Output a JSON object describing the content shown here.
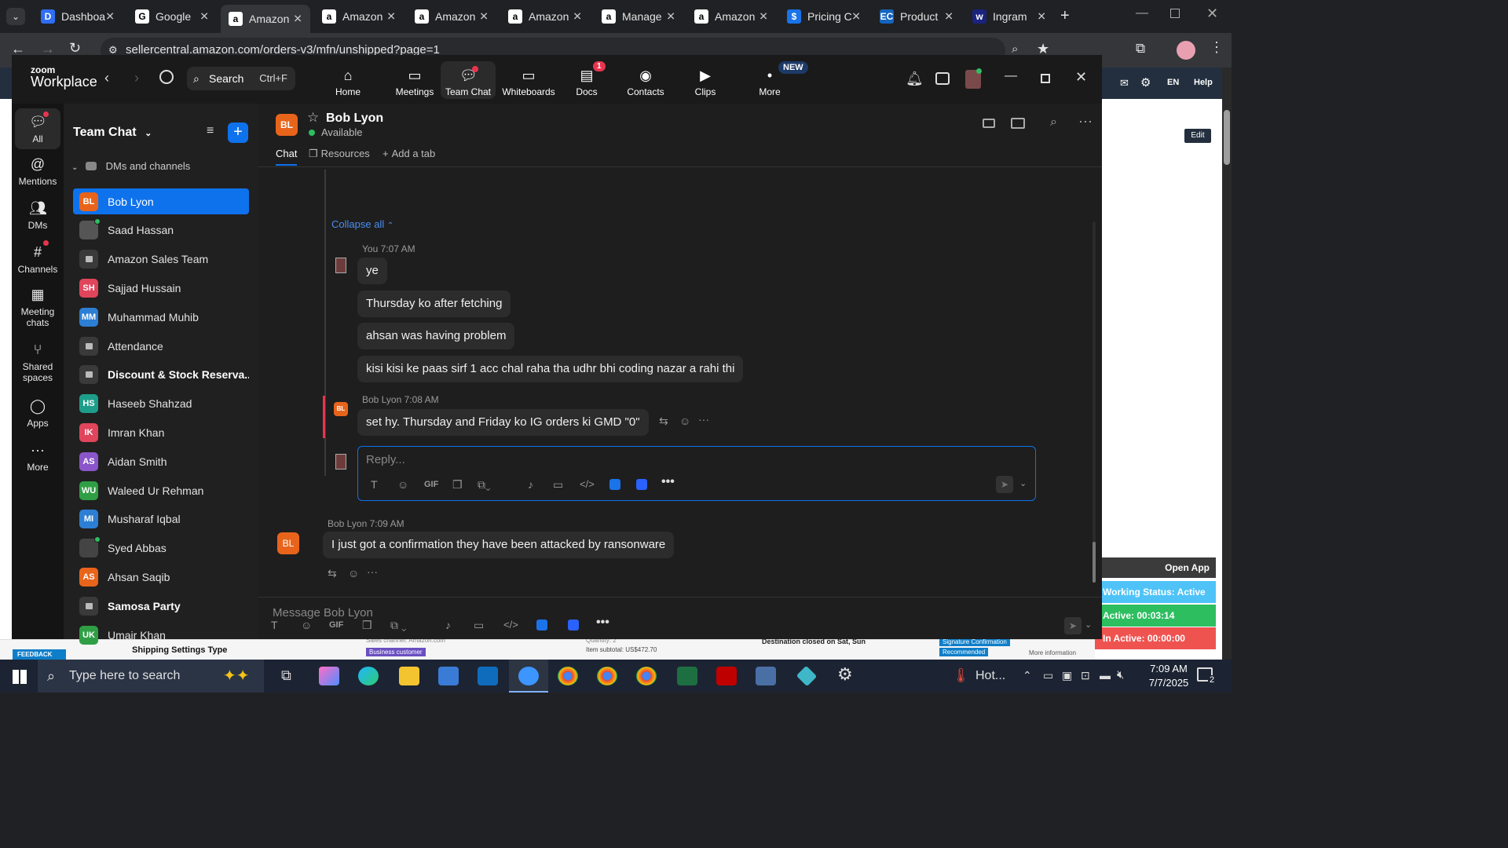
{
  "browser": {
    "tabs": [
      {
        "label": "Dashboa",
        "fav": "D",
        "color": "#2f6df5"
      },
      {
        "label": "Google",
        "fav": "G",
        "color": "#ffffff"
      },
      {
        "label": "Amazon",
        "fav": "a",
        "color": "#ffffff",
        "active": true
      },
      {
        "label": "Amazon",
        "fav": "a",
        "color": "#ffffff"
      },
      {
        "label": "Amazon",
        "fav": "a",
        "color": "#ffffff"
      },
      {
        "label": "Amazon",
        "fav": "a",
        "color": "#ffffff"
      },
      {
        "label": "Manage",
        "fav": "a",
        "color": "#ffffff"
      },
      {
        "label": "Amazon",
        "fav": "a",
        "color": "#ffffff"
      },
      {
        "label": "Pricing C",
        "fav": "$",
        "color": "#1a73e8"
      },
      {
        "label": "Product",
        "fav": "EC",
        "color": "#1565c0"
      },
      {
        "label": "Ingram",
        "fav": "w",
        "color": "#1a237e"
      }
    ],
    "url": "sellercentral.amazon.com/orders-v3/mfn/unshipped?page=1"
  },
  "amazon_bg": {
    "help": "Help",
    "lang": "EN",
    "edit": "Edit",
    "shipping_settings": "Shipping Settings Type",
    "feedback": "FEEDBACK",
    "footer_snippets": [
      "Sales channel: Amazon.com",
      "Business customer",
      "Quantity: 2",
      "Item subtotal: US$472.70",
      "Destination closed on Sat, Sun",
      "Signature Confirmation",
      "Recommended",
      "More information"
    ],
    "open_app": "Open App",
    "status": {
      "working": "Working Status: Active",
      "active": "Active: 00:03:14",
      "inactive": "In Active: 00:00:00"
    }
  },
  "zoom": {
    "logo_line1": "zoom",
    "logo_line2": "Workplace",
    "search": {
      "label": "Search",
      "shortcut": "Ctrl+F"
    },
    "nav": [
      {
        "label": "Home"
      },
      {
        "label": "Meetings"
      },
      {
        "label": "Team Chat",
        "active": true
      },
      {
        "label": "Whiteboards"
      },
      {
        "label": "Docs",
        "badge": "1"
      },
      {
        "label": "Contacts"
      },
      {
        "label": "Clips"
      },
      {
        "label": "More",
        "badge": "NEW"
      }
    ],
    "rail": [
      {
        "label": "All"
      },
      {
        "label": "Mentions"
      },
      {
        "label": "DMs"
      },
      {
        "label": "Channels"
      },
      {
        "label": "Meeting chats"
      },
      {
        "label": "Shared spaces"
      },
      {
        "label": "Apps"
      },
      {
        "label": "More"
      }
    ],
    "sidebar": {
      "title": "Team Chat",
      "section": "DMs and channels",
      "items": [
        {
          "name": "Bob Lyon",
          "initials": "BL",
          "color": "#e8641b",
          "selected": true
        },
        {
          "name": "Saad Hassan",
          "initials": "",
          "color": "#555555",
          "photo": true
        },
        {
          "name": "Amazon Sales Team",
          "lock": true
        },
        {
          "name": "Sajjad Hussain",
          "initials": "SH",
          "color": "#e0455b"
        },
        {
          "name": "Muhammad Muhib",
          "initials": "MM",
          "color": "#2d7fd3"
        },
        {
          "name": "Attendance",
          "lock": true
        },
        {
          "name": "Discount & Stock Reserva...",
          "lock": true,
          "bold": true
        },
        {
          "name": "Haseeb Shahzad",
          "initials": "HS",
          "color": "#1e9e8a"
        },
        {
          "name": "Imran Khan",
          "initials": "IK",
          "color": "#e0455b"
        },
        {
          "name": "Aidan Smith",
          "initials": "AS",
          "color": "#8a56c9"
        },
        {
          "name": "Waleed Ur Rehman",
          "initials": "WU",
          "color": "#2f9e44"
        },
        {
          "name": "Musharaf Iqbal",
          "initials": "MI",
          "color": "#2d7fd3"
        },
        {
          "name": "Syed Abbas",
          "initials": "",
          "color": "#444444",
          "photo": true
        },
        {
          "name": "Ahsan Saqib",
          "initials": "AS",
          "color": "#e8641b"
        },
        {
          "name": "Samosa Party",
          "lock": true,
          "bold": true
        },
        {
          "name": "Umair Khan",
          "initials": "UK",
          "color": "#2f9e44"
        }
      ]
    },
    "chat": {
      "contact": "Bob Lyon",
      "initials": "BL",
      "status": "Available",
      "tabs": [
        "Chat",
        "Resources",
        "Add a tab"
      ],
      "collapse": "Collapse all",
      "thread": {
        "you_meta": "You 7:07 AM",
        "you_msgs": [
          "ye",
          "Thursday ko after fetching",
          "ahsan was having problem",
          "kisi kisi ke paas sirf 1 acc chal raha tha udhr bhi coding nazar a rahi thi"
        ],
        "bob_meta": "Bob Lyon 7:08 AM",
        "bob_msg": "set hy. Thursday and Friday ko IG orders ki GMD \"0\"",
        "reply_placeholder": "Reply..."
      },
      "last": {
        "meta": "Bob Lyon 7:09 AM",
        "msg": "I just got a confirmation they have been attacked by ransonware"
      },
      "composer_placeholder": "Message Bob Lyon",
      "toolbar": {
        "gif": "GIF"
      }
    }
  },
  "taskbar": {
    "search": "Type here to search",
    "weather": "Hot...",
    "time": "7:09 AM",
    "date": "7/7/2025",
    "notif_count": "2"
  }
}
